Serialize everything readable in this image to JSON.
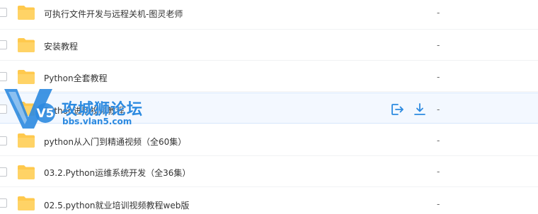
{
  "files": [
    {
      "name": "可执行文件开发与远程关机-图灵老师",
      "size": "-"
    },
    {
      "name": "安装教程",
      "size": "-"
    },
    {
      "name": "Python全套教程",
      "size": "-"
    },
    {
      "name": "Python进阶视频教程",
      "size": "-"
    },
    {
      "name": "python从入门到精通视频（全60集）",
      "size": "-"
    },
    {
      "name": "03.2.Python运维系统开发（全36集）",
      "size": "-"
    },
    {
      "name": "02.5.python就业培训视频教程web版",
      "size": "-"
    }
  ],
  "hover_actions": {
    "share_icon": "share-out-icon",
    "download_icon": "download-icon"
  },
  "watermark": {
    "title": "攻城狮论坛",
    "url": "bbs.vlan5.com",
    "logo_text": "V5"
  },
  "colors": {
    "folder": "#ffc94d",
    "accent": "#2c8ae0",
    "hover_bg": "#f3f8ff"
  }
}
